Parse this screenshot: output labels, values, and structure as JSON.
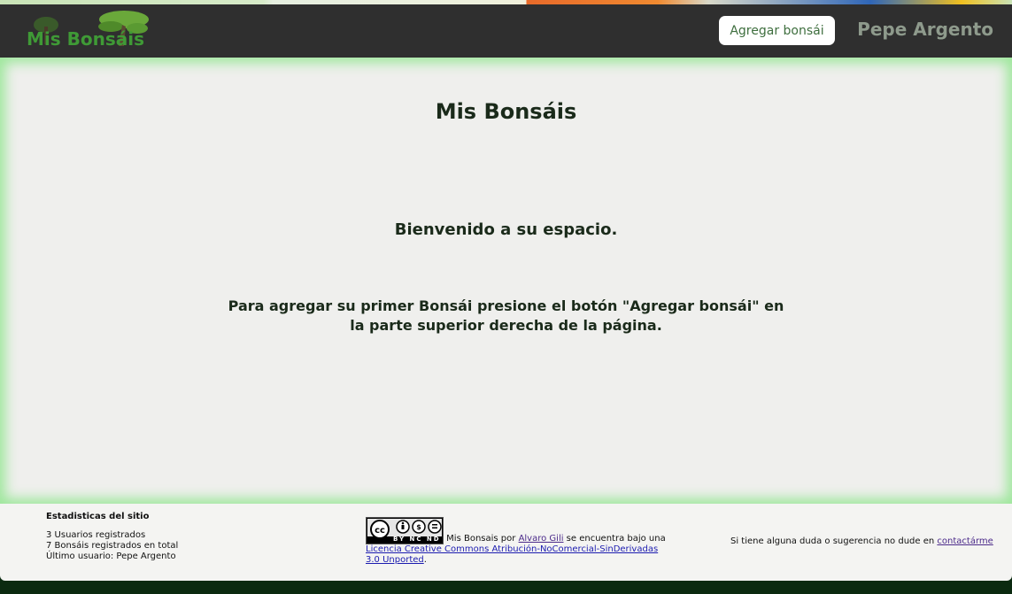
{
  "header": {
    "logo_text": "Mis Bonsáis",
    "add_button_label": "Agregar bonsái",
    "user_name": "Pepe Argento"
  },
  "main": {
    "title": "Mis Bonsáis",
    "welcome": "Bienvenido a su espacio.",
    "instructions": "Para agregar su primer Bonsái presione el botón \"Agregar bonsái\" en la parte superior derecha de la página."
  },
  "footer": {
    "stats": {
      "title": "Estadisticas del sitio",
      "registered_users": "3 Usuarios registrados",
      "registered_bonsais": "7 Bonsáis registrados en total",
      "last_user": "Último usuario: Pepe Argento"
    },
    "license": {
      "badge_text": "BY NC ND",
      "text_before": " Mis Bonsais por ",
      "author_link": "Alvaro Gili",
      "text_middle": " se encuentra bajo una ",
      "license_link": "Licencia Creative Commons Atribución-NoComercial-SinDerivadas 3.0 Unported",
      "text_after": "."
    },
    "contact": {
      "text": "Si tiene alguna duda o sugerencia no dude en ",
      "link": "contactárme"
    }
  },
  "colors": {
    "header_bg": "#2f2f2f",
    "main_bg": "#efefed",
    "glow": "#9ee79c",
    "logo_green": "#3f9a36",
    "page_bottom": "#0b2a10"
  }
}
